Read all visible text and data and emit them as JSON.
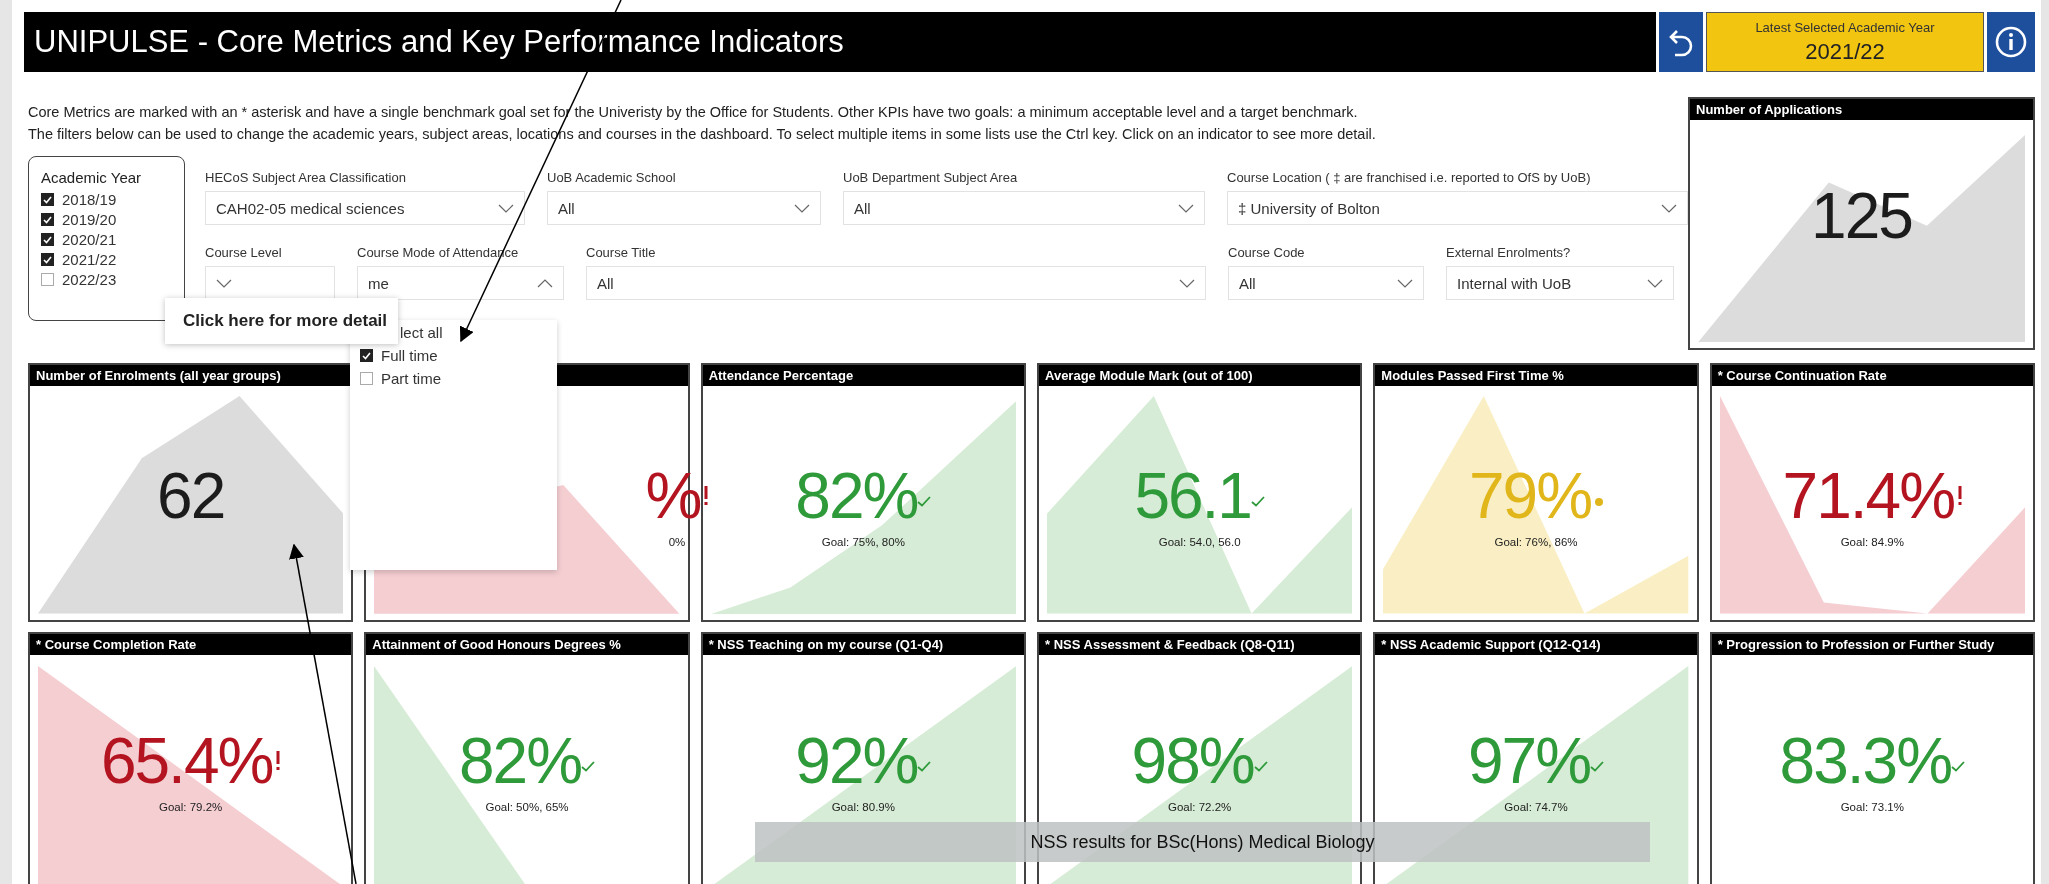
{
  "header": {
    "title": "UNIPULSE - Core Metrics and Key Performance Indicators"
  },
  "latest_year": {
    "label": "Latest Selected Academic Year",
    "value": "2021/22"
  },
  "intro": [
    "Core Metrics are marked with an * asterisk and have a single benchmark goal set for the Univeristy by the Office for Students.  Other KPIs have two goals: a minimum acceptable level and a target benchmark.",
    "The filters below can be used to change the academic years, subject areas, locations and courses in the dashboard.  To select multiple items in some lists use the Ctrl key.  Click on an indicator to see more detail."
  ],
  "academic_year": {
    "title": "Academic Year",
    "options": [
      {
        "label": "2018/19",
        "checked": true
      },
      {
        "label": "2019/20",
        "checked": true
      },
      {
        "label": "2020/21",
        "checked": true
      },
      {
        "label": "2021/22",
        "checked": true
      },
      {
        "label": "2022/23",
        "checked": false
      }
    ]
  },
  "filter_rows": [
    [
      {
        "label": "HECoS Subject Area Classification",
        "value": "CAH02-05 medical sciences",
        "expanded": false
      },
      {
        "label": "UoB Academic School",
        "value": "All",
        "expanded": false
      },
      {
        "label": "UoB Department Subject Area",
        "value": "All",
        "expanded": false
      },
      {
        "label": "Course Location ( ‡ are franchised i.e. reported to OfS by UoB)",
        "value": "‡ University of Bolton",
        "expanded": false
      }
    ],
    [
      {
        "label": "Course Level",
        "expanded": false
      },
      {
        "label": "Course Mode of Attendance",
        "value": "me",
        "expanded": true
      },
      {
        "label": "Course Title",
        "value": "All",
        "expanded": false
      },
      {
        "label": "Course Code",
        "value": "All",
        "expanded": false
      },
      {
        "label": "External Enrolments?",
        "value": "Internal with UoB",
        "expanded": false
      }
    ]
  ],
  "tooltip": "Click here for more detail",
  "mode_dropdown": {
    "partial_item": "lect all",
    "items": [
      {
        "label": "Full time",
        "checked": true
      },
      {
        "label": "Part time",
        "checked": false
      }
    ]
  },
  "applications": {
    "title": "Number of Applications",
    "value": "125",
    "kind": "neutral"
  },
  "kpi_rows": [
    [
      {
        "title": "Number of Enrolments (all year groups)",
        "value": "62",
        "kind": "neutral"
      },
      {
        "value": "%",
        "goal": "0%",
        "kind": "bad"
      },
      {
        "title": "Attendance Percentage",
        "value": "82%",
        "goal": "Goal: 75%, 80%",
        "kind": "good"
      },
      {
        "title": "Average Module Mark (out of 100)",
        "value": "56.1",
        "goal": "Goal: 54.0, 56.0",
        "kind": "good"
      },
      {
        "title": "Modules Passed First Time %",
        "value": "79%",
        "goal": "Goal: 76%, 86%",
        "kind": "amber"
      },
      {
        "title": "* Course Continuation Rate",
        "value": "71.4%",
        "goal": "Goal: 84.9%",
        "kind": "bad"
      }
    ],
    [
      {
        "title": "* Course Completion Rate",
        "value": "65.4%",
        "goal": "Goal: 79.2%",
        "kind": "bad"
      },
      {
        "title": "Attainment of Good Honours Degrees %",
        "value": "82%",
        "goal": "Goal: 50%, 65%",
        "kind": "good"
      },
      {
        "title": "* NSS Teaching on my course (Q1-Q4)",
        "value": "92%",
        "goal": "Goal: 80.9%",
        "kind": "good"
      },
      {
        "title": "* NSS Assessment & Feedback (Q8-Q11)",
        "value": "98%",
        "goal": "Goal: 72.2%",
        "kind": "good"
      },
      {
        "title": "* NSS Academic Support (Q12-Q14)",
        "value": "97%",
        "goal": "Goal: 74.7%",
        "kind": "good"
      },
      {
        "title": "* Progression to Profession or Further Study",
        "value": "83.3%",
        "goal": "Goal: 73.1%",
        "kind": "good"
      }
    ]
  ],
  "banner": "NSS results for BSc(Hons) Medical Biology"
}
